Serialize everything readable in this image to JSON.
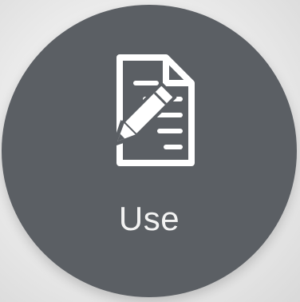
{
  "tile": {
    "label": "Use",
    "icon": "document-edit-icon",
    "background_color": "#5b5f64",
    "foreground_color": "#ffffff"
  }
}
